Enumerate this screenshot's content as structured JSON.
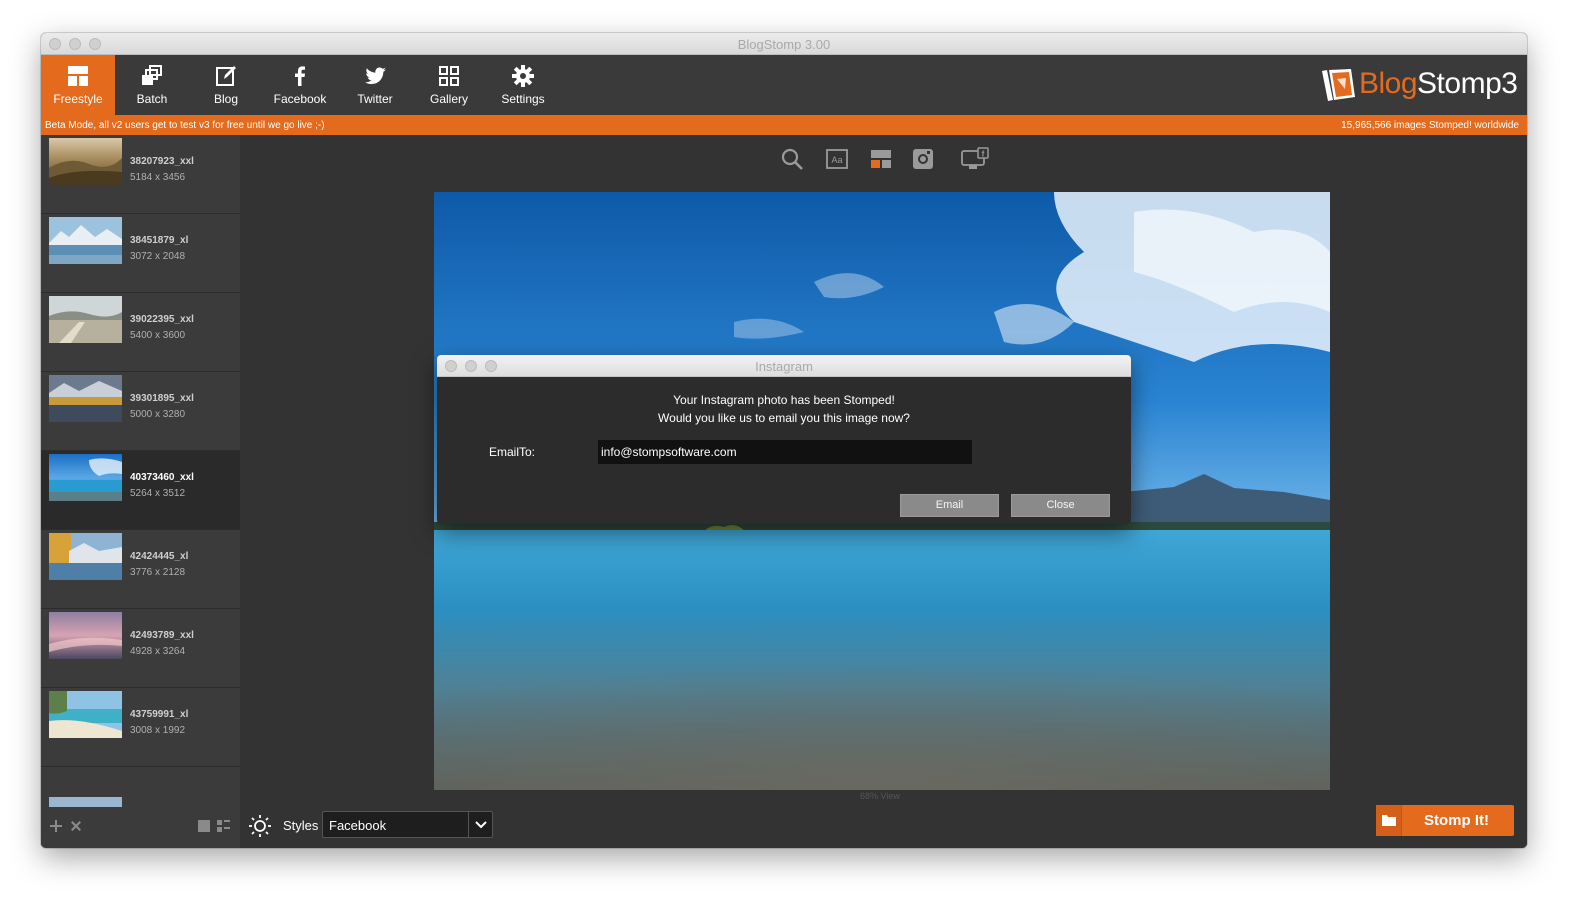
{
  "window": {
    "title": "BlogStomp 3.00"
  },
  "toolbar": {
    "items": [
      {
        "label": "Freestyle",
        "icon": "freestyle-icon",
        "active": true
      },
      {
        "label": "Batch",
        "icon": "batch-icon"
      },
      {
        "label": "Blog",
        "icon": "blog-edit-icon"
      },
      {
        "label": "Facebook",
        "icon": "facebook-icon"
      },
      {
        "label": "Twitter",
        "icon": "twitter-icon"
      },
      {
        "label": "Gallery",
        "icon": "gallery-grid-icon"
      },
      {
        "label": "Settings",
        "icon": "gear-icon"
      }
    ],
    "logo_blog": "Blog",
    "logo_stomp": "Stomp3"
  },
  "beta_bar": {
    "left": "Beta Mode, all v2 users get to test v3 for free until we go live ;-)",
    "right": "15,965,566 images Stomped! worldwide"
  },
  "sidebar": {
    "items": [
      {
        "name": "38207923_xxl",
        "size": "5184 x 3456"
      },
      {
        "name": "38451879_xl",
        "size": "3072 x 2048"
      },
      {
        "name": "39022395_xxl",
        "size": "5400 x 3600"
      },
      {
        "name": "39301895_xxl",
        "size": "5000 x 3280"
      },
      {
        "name": "40373460_xxl",
        "size": "5264 x 3512",
        "selected": true
      },
      {
        "name": "42424445_xl",
        "size": "3776 x 2128"
      },
      {
        "name": "42493789_xxl",
        "size": "4928 x 3264"
      },
      {
        "name": "43759991_xl",
        "size": "3008 x 1992"
      }
    ]
  },
  "editor": {
    "view_label": "68% View",
    "styles_label": "Styles",
    "styles_value": "Facebook",
    "stomp_label": "Stomp It!"
  },
  "dialog": {
    "title": "Instagram",
    "line1": "Your Instagram photo has been Stomped!",
    "line2": "Would you like us to email you this image now?",
    "email_label": "EmailTo:",
    "email_value": "info@stompsoftware.com",
    "email_button": "Email",
    "close_button": "Close"
  },
  "colors": {
    "accent": "#e46b1e",
    "background": "#333333",
    "sidebar": "#3b3b3b"
  }
}
